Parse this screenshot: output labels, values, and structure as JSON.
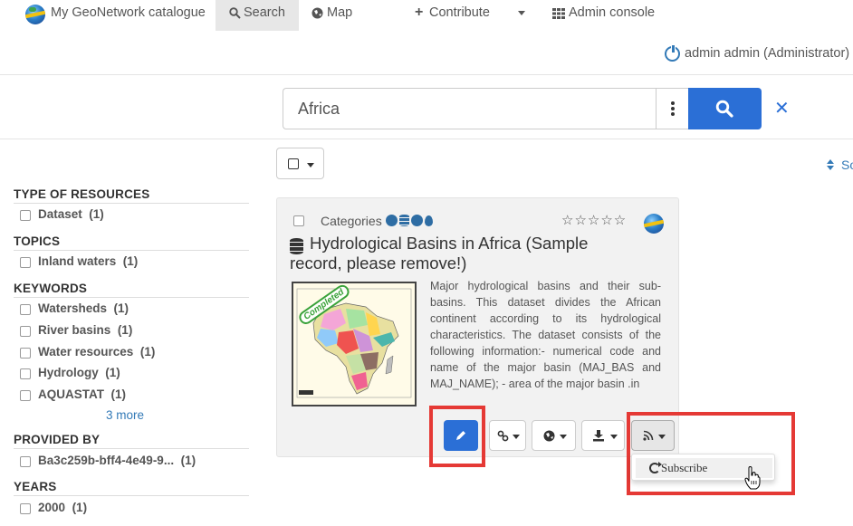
{
  "navbar": {
    "brand": "My GeoNetwork catalogue",
    "search": "Search",
    "map": "Map",
    "contribute": "Contribute",
    "admin_console": "Admin console"
  },
  "user": {
    "label": "admin admin (Administrator)"
  },
  "search": {
    "value": "Africa"
  },
  "sort": {
    "label": "So"
  },
  "facets": {
    "type_of_resources": {
      "title": "TYPE OF RESOURCES",
      "items": [
        {
          "label": "Dataset",
          "count": "(1)"
        }
      ]
    },
    "topics": {
      "title": "TOPICS",
      "items": [
        {
          "label": "Inland waters",
          "count": "(1)"
        }
      ]
    },
    "keywords": {
      "title": "KEYWORDS",
      "items": [
        {
          "label": "Watersheds",
          "count": "(1)"
        },
        {
          "label": "River basins",
          "count": "(1)"
        },
        {
          "label": "Water resources",
          "count": "(1)"
        },
        {
          "label": "Hydrology",
          "count": "(1)"
        },
        {
          "label": "AQUASTAT",
          "count": "(1)"
        }
      ],
      "more": "3  more"
    },
    "provided_by": {
      "title": "PROVIDED BY",
      "items": [
        {
          "label": "Ba3c259b-bff4-4e49-9...",
          "count": "(1)"
        }
      ]
    },
    "years": {
      "title": "YEARS",
      "items": [
        {
          "label": "2000",
          "count": "(1)"
        }
      ]
    }
  },
  "record": {
    "categories_label": "Categories",
    "rating": "☆☆☆☆☆",
    "title": "Hydrological Basins in Africa (Sample record, please remove!)",
    "status_stamp": "Completed",
    "abstract": "Major hydrological basins and their sub-basins. This dataset divides the African continent according to its hydrological characteristics. The dataset consists of the following information:- numerical code and name of the major basin (MAJ_BAS and MAJ_NAME); - area of the major basin .in"
  },
  "dropdown": {
    "subscribe": "Subscribe"
  },
  "colors": {
    "primary": "#2b6fd6",
    "highlight_frame": "#e53935",
    "link": "#337ab7"
  }
}
